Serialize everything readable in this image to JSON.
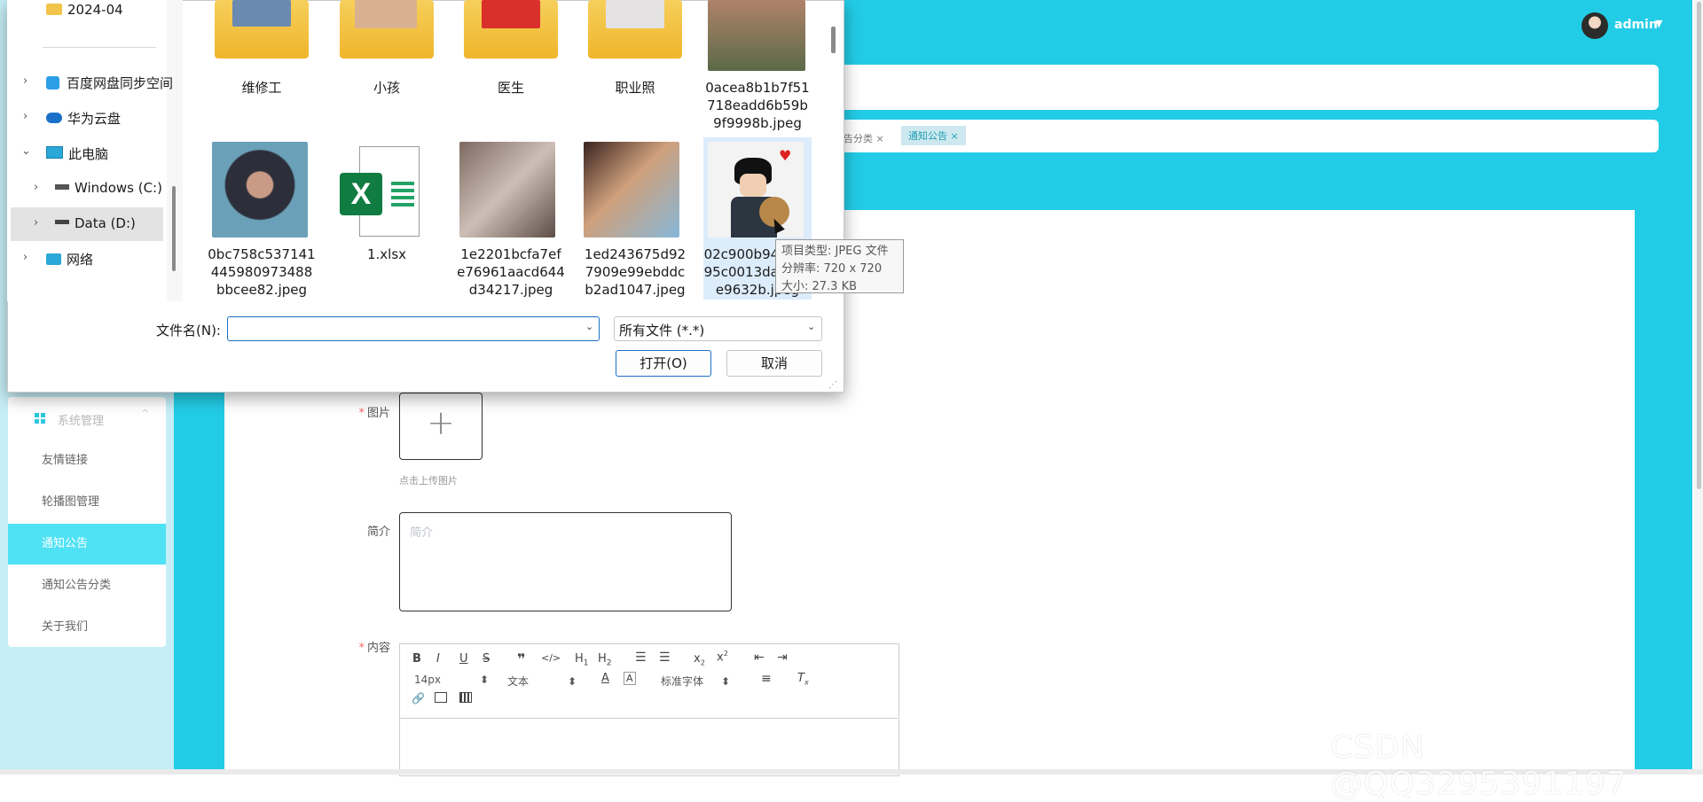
{
  "app": {
    "user": "admin",
    "tags": [
      "公告分类",
      "通知公告"
    ],
    "sidebar": {
      "group": "系统管理",
      "items": [
        "友情链接",
        "轮播图管理",
        "通知公告",
        "通知公告分类",
        "关于我们"
      ],
      "active_index": 2
    },
    "form": {
      "image_label": "图片",
      "upload_tip": "点击上传图片",
      "intro_label": "简介",
      "intro_placeholder": "简介",
      "content_label": "内容",
      "editor": {
        "font_size": "14px",
        "paragraph": "文本",
        "font_family": "标准字体"
      }
    }
  },
  "dialog": {
    "nav": {
      "items": [
        {
          "label": "2024-04",
          "icon": "folder-icon"
        },
        {
          "label": "百度网盘同步空间",
          "icon": "baidu-cloud-icon"
        },
        {
          "label": "华为云盘",
          "icon": "huawei-cloud-icon"
        },
        {
          "label": "此电脑",
          "icon": "computer-icon"
        },
        {
          "label": "Windows (C:)",
          "icon": "drive-icon"
        },
        {
          "label": "Data (D:)",
          "icon": "drive-icon"
        },
        {
          "label": "网络",
          "icon": "network-icon"
        }
      ]
    },
    "files_row1": [
      "维修工",
      "小孩",
      "医生",
      "职业照",
      "0acea8b1b7f51718eadd6b59b9f9998b.jpeg"
    ],
    "files_row2": [
      "0bc758c537141445980973488bbcee82.jpeg",
      "1.xlsx",
      "1e2201bcfa7efe76961aacd644d34217.jpeg",
      "1ed243675d927909e99ebddcb2ad1047.jpeg",
      "02c900b94a4ce95c0013da00cae9632b.jpeg"
    ],
    "file_lines": {
      "f5": [
        "0acea8b1b7f51",
        "718eadd6b59b",
        "9f9998b.jpeg"
      ],
      "g1": [
        "0bc758c537141",
        "445980973488",
        "bbcee82.jpeg"
      ],
      "g3": [
        "1e2201bcfa7ef",
        "e76961aacd644",
        "d34217.jpeg"
      ],
      "g4": [
        "1ed243675d92",
        "7909e99ebddc",
        "b2ad1047.jpeg"
      ],
      "g5": [
        "02c900b94a4ce",
        "95c0013da00ca",
        "e9632b.jpeg"
      ]
    },
    "tooltip": {
      "type": "项目类型: JPEG 文件",
      "dims": "分辨率: 720 x 720",
      "size": "大小: 27.3 KB"
    },
    "filename_label": "文件名(N):",
    "filename_value": "",
    "filetype": "所有文件 (*.*)",
    "open_label": "打开(O)",
    "cancel_label": "取消"
  },
  "watermark": "CSDN @QQ3295391197",
  "colors": {
    "accent": "#22cce6",
    "sidebar_active": "#4fe2f4",
    "dialog_focus": "#1a6fc9"
  }
}
